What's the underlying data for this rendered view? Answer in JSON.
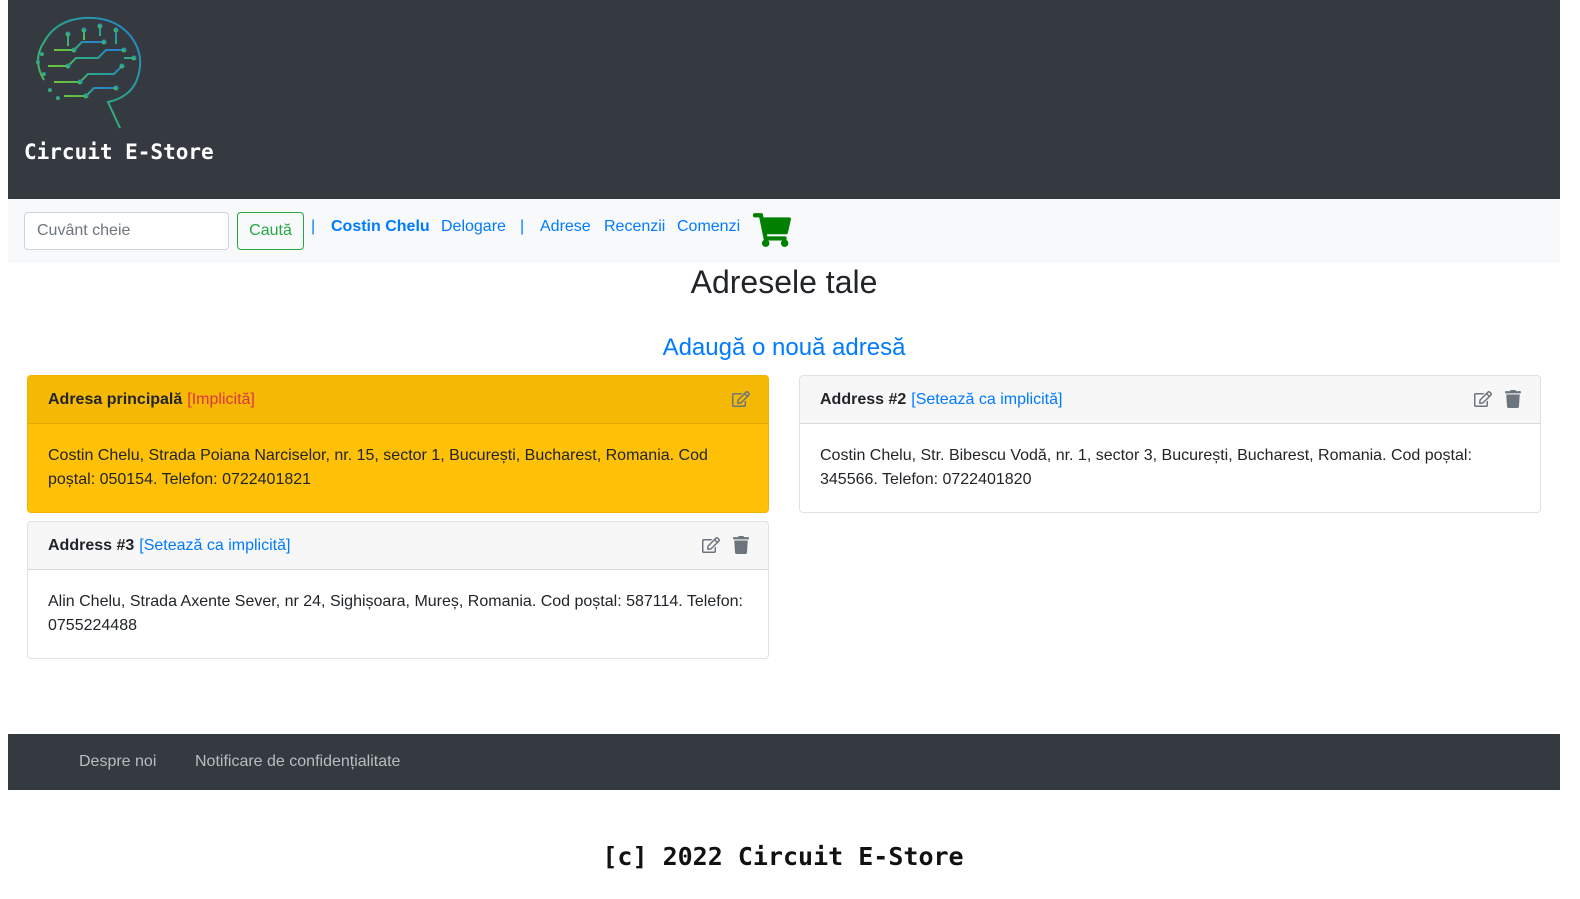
{
  "header": {
    "brand": "Circuit E-Store",
    "logo_icon": "circuit-brain-icon"
  },
  "navbar": {
    "search_placeholder": "Cuvânt cheie",
    "search_button": "Caută",
    "separator": "|",
    "user_name": "Costin Chelu",
    "logout": "Delogare",
    "addresses": "Adrese",
    "reviews": "Recenzii",
    "orders": "Comenzi",
    "cart_icon": "shopping-cart-icon",
    "cart_color": "#008000"
  },
  "main": {
    "title": "Adresele tale",
    "add_link": "Adaugă o nouă adresă",
    "addresses": [
      {
        "title": "Adresa principală",
        "status": "[Implicită]",
        "body": "Costin Chelu, Strada Poiana Narciselor, nr. 15, sector 1, București, Bucharest, Romania. Cod poștal: 050154. Telefon: 0722401821",
        "highlight_color": "#ffc107"
      },
      {
        "title": "Address #2",
        "status": "[Setează ca implicită]",
        "body": "Costin Chelu, Str. Bibescu Vodă, nr. 1, sector 3, București, Bucharest, Romania. Cod poștal: 345566. Telefon: 0722401820"
      },
      {
        "title": "Address #3",
        "status": "[Setează ca implicită]",
        "body": "Alin Chelu, Strada Axente Sever, nr 24, Sighișoara, Mureș, Romania. Cod poștal: 587114. Telefon: 0755224488"
      }
    ]
  },
  "footer": {
    "about": "Despre noi",
    "privacy": "Notificare de confidențialitate",
    "copyright": "[c] 2022 Circuit E-Store"
  },
  "colors": {
    "dark": "#343a40",
    "link": "#007bff",
    "success": "#28a745",
    "warning": "#ffc107",
    "danger": "#dc3545"
  }
}
